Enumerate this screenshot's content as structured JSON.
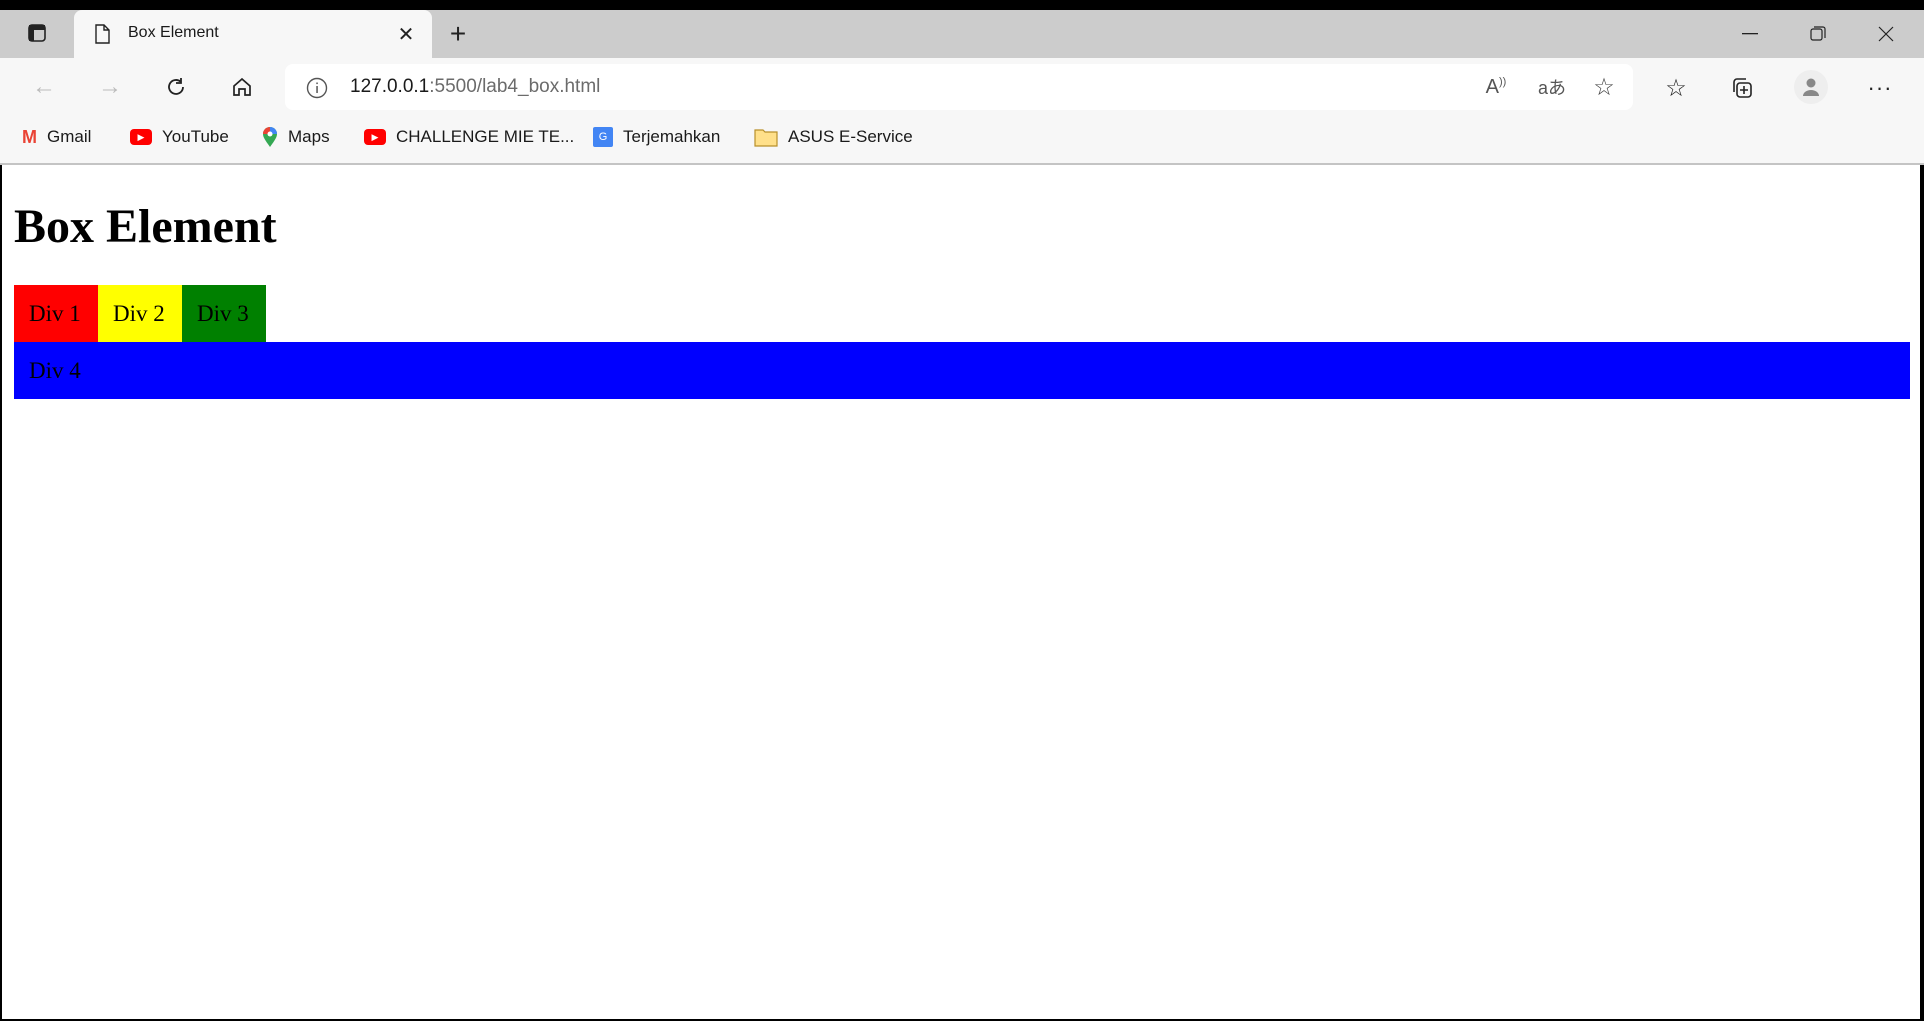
{
  "browser": {
    "tab_title": "Box Element",
    "url_host": "127.0.0.1",
    "url_rest": ":5500/lab4_box.html",
    "bookmarks": [
      {
        "label": "Gmail",
        "icon": "gmail-icon"
      },
      {
        "label": "YouTube",
        "icon": "youtube-icon"
      },
      {
        "label": "Maps",
        "icon": "maps-icon"
      },
      {
        "label": "CHALLENGE MIE TE...",
        "icon": "youtube-icon"
      },
      {
        "label": "Terjemahkan",
        "icon": "translate-icon"
      },
      {
        "label": "ASUS E-Service",
        "icon": "folder-icon"
      }
    ]
  },
  "page": {
    "heading": "Box Element",
    "boxes": [
      {
        "label": "Div 1",
        "color": "#ff0000"
      },
      {
        "label": "Div 2",
        "color": "#ffff00"
      },
      {
        "label": "Div 3",
        "color": "#008000"
      },
      {
        "label": "Div 4",
        "color": "#0000ff"
      }
    ]
  }
}
